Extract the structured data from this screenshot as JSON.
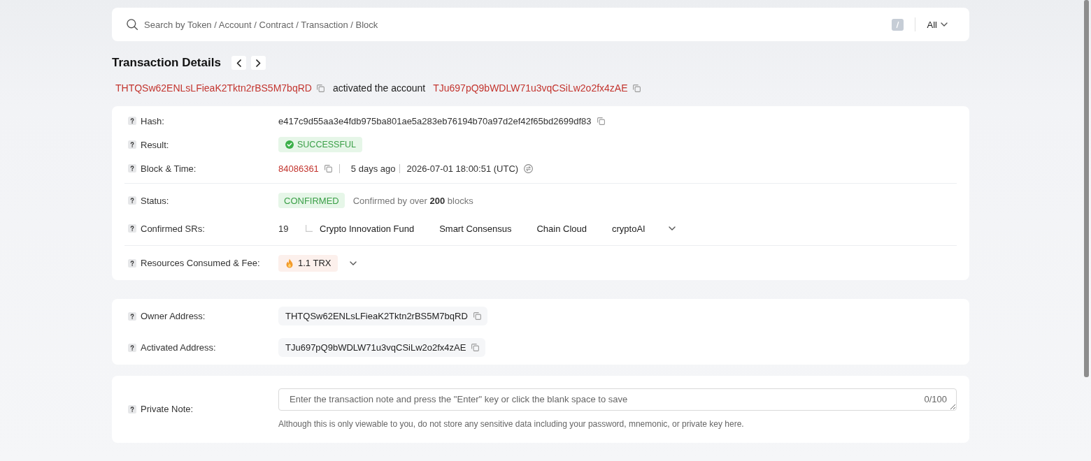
{
  "search": {
    "placeholder": "Search by Token / Account / Contract / Transaction / Block",
    "filter": "All"
  },
  "header": {
    "title": "Transaction Details"
  },
  "summary": {
    "from_address": "THTQSw62ENLsLFieaK2Tktn2rBS5M7bqRD",
    "action": "activated the account",
    "to_address": "TJu697pQ9bWDLW71u3vqCSiLw2o2fx4zAE"
  },
  "overview": {
    "groups": [
      {
        "rows": [
          {
            "kind": "hash",
            "label": "Hash:",
            "value": "e417c9d55aa3e4fdb975ba801ae5a283eb76194b70a97d2ef42f65bd2699df83"
          },
          {
            "kind": "result",
            "label": "Result:",
            "value": "SUCCESSFUL"
          },
          {
            "kind": "block_time",
            "label": "Block & Time:",
            "block": "84086361",
            "age": "5 days ago",
            "timestamp": "2026-07-01 18:00:51 (UTC)"
          }
        ]
      },
      {
        "rows": [
          {
            "kind": "status",
            "label": "Status:",
            "value": "CONFIRMED",
            "note": "Confirmed by over **200** blocks"
          },
          {
            "kind": "srs",
            "label": "Confirmed SRs:",
            "count": "19",
            "names": [
              "Crypto Innovation Fund",
              "Smart Consensus",
              "Chain Cloud",
              "cryptoAI"
            ]
          }
        ]
      },
      {
        "rows": [
          {
            "kind": "fee",
            "label": "Resources Consumed & Fee:",
            "value": "1.1 TRX"
          }
        ]
      }
    ]
  },
  "addresses": {
    "rows": [
      {
        "label": "Owner Address:",
        "value": "THTQSw62ENLsLFieaK2Tktn2rBS5M7bqRD"
      },
      {
        "label": "Activated Address:",
        "value": "TJu697pQ9bWDLW71u3vqCSiLw2o2fx4zAE"
      }
    ]
  },
  "private_note": {
    "label": "Private Note:",
    "placeholder": "Enter the transaction note and press the \"Enter\" key or click the blank space to save",
    "counter": "0/100",
    "hint": "Although this is only viewable to you, do not store any sensitive data including your password, mnemonic, or private key here."
  }
}
